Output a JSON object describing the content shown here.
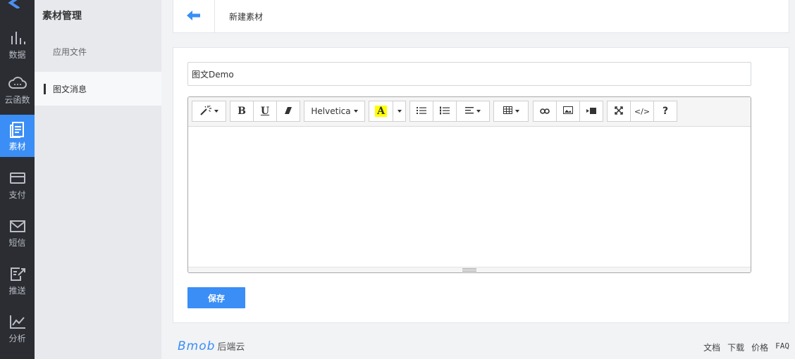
{
  "rail": {
    "items": [
      {
        "label": "数据",
        "icon": "bar-chart-icon"
      },
      {
        "label": "云函数",
        "icon": "cloud-icon"
      },
      {
        "label": "素材",
        "icon": "document-icon",
        "active": true
      },
      {
        "label": "支付",
        "icon": "credit-card-icon"
      },
      {
        "label": "短信",
        "icon": "mail-icon"
      },
      {
        "label": "推送",
        "icon": "edit-export-icon"
      },
      {
        "label": "分析",
        "icon": "line-chart-icon"
      }
    ]
  },
  "subnav": {
    "title": "素材管理",
    "items": [
      {
        "label": "应用文件"
      },
      {
        "label": "图文消息",
        "active": true
      }
    ]
  },
  "header": {
    "title": "新建素材"
  },
  "form": {
    "title_value": "图文Demo",
    "font_name": "Helvetica",
    "save_label": "保存"
  },
  "footer": {
    "brand": "Bmob",
    "brand_cn": "后端云",
    "links": [
      "文档",
      "下载",
      "价格",
      "FAQ"
    ]
  },
  "colors": {
    "accent": "#3a8ef6",
    "rail_bg": "#2b2d33",
    "highlight": "#ffff00"
  }
}
